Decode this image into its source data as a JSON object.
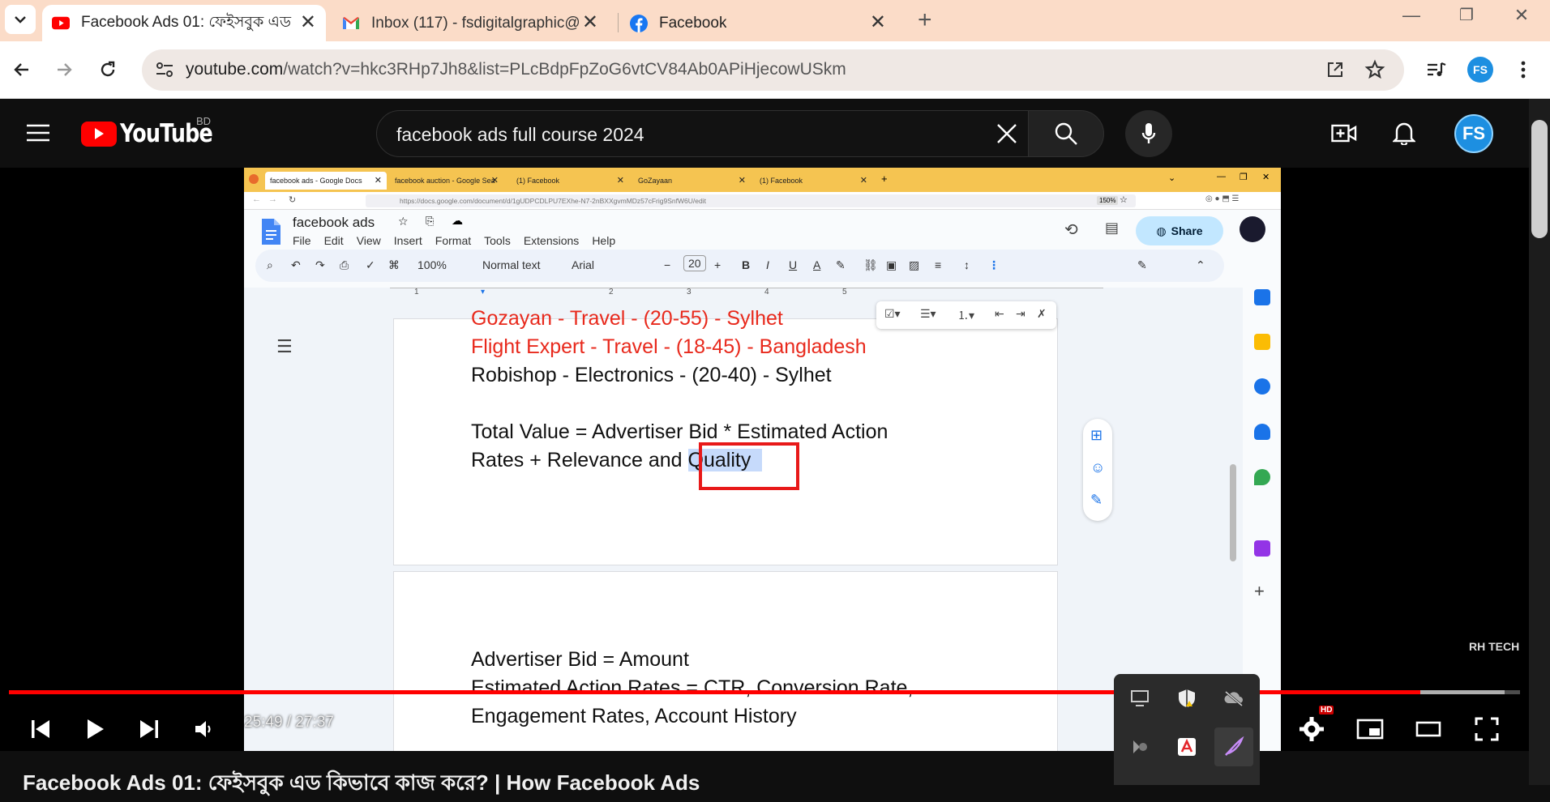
{
  "browser": {
    "tabs": [
      {
        "title": "Facebook Ads 01: ফেইসবুক এড",
        "icon": "youtube-icon",
        "active": true
      },
      {
        "title": "Inbox (117) - fsdigitalgraphic@",
        "icon": "gmail-icon",
        "active": false
      },
      {
        "title": "Facebook",
        "icon": "facebook-icon",
        "active": false
      }
    ],
    "url_host": "youtube.com",
    "url_rest": "/watch?v=hkc3RHp7Jh8&list=PLcBdpFpZoG6vtCV84Ab0APiHjecowUSkm"
  },
  "youtube": {
    "logo_text": "YouTube",
    "country": "BD",
    "search_query": "facebook ads full course 2024",
    "avatar_text": "FS",
    "video_title": "Facebook Ads 01: ফেইসবুক এড কিভাবে কাজ করে? | How Facebook Ads"
  },
  "player": {
    "current_time": "25:49",
    "duration": "27:37",
    "time_display": "25:49 / 27:37",
    "progress_fraction": 0.934,
    "buffered_fraction": 0.99,
    "quality_badge": "HD"
  },
  "video_frame": {
    "firefox_tabs": [
      {
        "title": "facebook ads - Google Docs",
        "active": true
      },
      {
        "title": "facebook auction - Google Sea",
        "active": false
      },
      {
        "title": "(1) Facebook",
        "active": false
      },
      {
        "title": "GoZayaan",
        "active": false
      },
      {
        "title": "(1) Facebook",
        "active": false
      }
    ],
    "firefox_url": "https://docs.google.com/document/d/1gUDPCDLPU7EXhe-N7-2nBXXgvmMDz57cFrig9SnfW6U/edit",
    "zoom_badge": "150%",
    "doc_title": "facebook ads",
    "menu": [
      "File",
      "Edit",
      "View",
      "Insert",
      "Format",
      "Tools",
      "Extensions",
      "Help"
    ],
    "share_label": "Share",
    "toolbar": {
      "zoom": "100%",
      "style": "Normal text",
      "font": "Arial",
      "size": "20"
    },
    "ruler_marks": [
      "1",
      "2",
      "3",
      "4",
      "5"
    ],
    "lines": [
      {
        "text": "Gozayan - Travel - (20-55) - Sylhet",
        "color": "#e8291c"
      },
      {
        "text": "Flight Expert - Travel - (18-45) - Bangladesh",
        "color": "#e8291c"
      },
      {
        "text": "Robishop - Electronics - (20-40) - Sylhet",
        "color": "#111111"
      },
      {
        "text": "Total Value = Advertiser Bid * Estimated Action",
        "color": "#111111"
      },
      {
        "text_before": "Rates + Relevance and ",
        "text_highlight": "Quality",
        "color": "#111111"
      },
      {
        "text": "Advertiser Bid = Amount",
        "color": "#111111"
      },
      {
        "text": "Estimated Action Rates = CTR, Conversion Rate,",
        "color": "#111111"
      },
      {
        "text": "Engagement Rates, Account History",
        "color": "#111111"
      }
    ],
    "watermark": "RH TECH"
  },
  "colors": {
    "yt_red": "#ff0000",
    "chrome_tab_bg": "#fbdcc8",
    "ff_tab_bg": "#f5c451",
    "share_bg": "#c2e7ff"
  }
}
